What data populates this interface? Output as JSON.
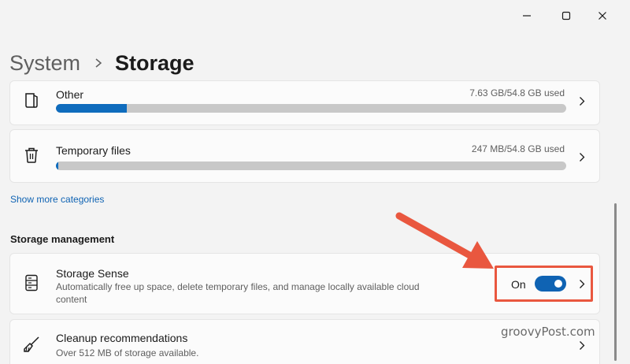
{
  "breadcrumb": {
    "parent": "System",
    "current": "Storage"
  },
  "categories": [
    {
      "name": "Other",
      "usage": "7.63 GB/54.8 GB used",
      "fraction": 0.139,
      "icon": "document-icon"
    },
    {
      "name": "Temporary files",
      "usage": "247 MB/54.8 GB used",
      "fraction": 0.005,
      "icon": "trash-icon"
    }
  ],
  "show_more": "Show more categories",
  "storage_management": {
    "heading": "Storage management",
    "storage_sense": {
      "title": "Storage Sense",
      "description_line1": "Automatically free up space, delete temporary files, and manage locally available cloud",
      "description_line2": "content",
      "toggle_label": "On",
      "toggle_on": true,
      "icon": "drive-icon"
    },
    "cleanup": {
      "title": "Cleanup recommendations",
      "description": "Over 512 MB of storage available.",
      "icon": "broom-icon"
    }
  },
  "watermark": "groovyPost.com",
  "colors": {
    "accent": "#0f63b3",
    "highlight": "#e9573f",
    "bar_track": "#c8c8c8"
  }
}
